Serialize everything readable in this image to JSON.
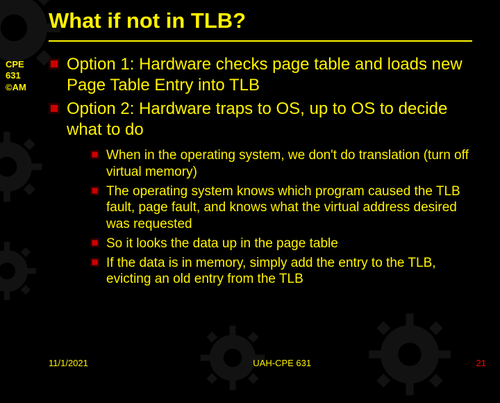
{
  "sidebar": "CPE 631 ©AM",
  "title": "What if not in TLB?",
  "main_bullets": [
    "Option 1: Hardware checks page table and loads new Page Table Entry into TLB",
    "Option 2: Hardware traps to OS, up to OS to decide what to do"
  ],
  "sub_bullets": [
    "When in the operating system, we don't do translation (turn off virtual memory)",
    "The operating system knows which program caused the TLB fault, page fault, and knows what the virtual address desired was requested",
    "So it looks the data up in the page table",
    "If the data is in memory, simply add the entry to the TLB, evicting an old entry from the TLB"
  ],
  "footer": {
    "date": "11/1/2021",
    "center": "UAH-CPE 631",
    "page": "21"
  },
  "colors": {
    "accent_yellow": "#FFF200",
    "bullet_red": "#CC0000",
    "bullet_dark": "#2A0000",
    "page_red": "#FF0000"
  }
}
